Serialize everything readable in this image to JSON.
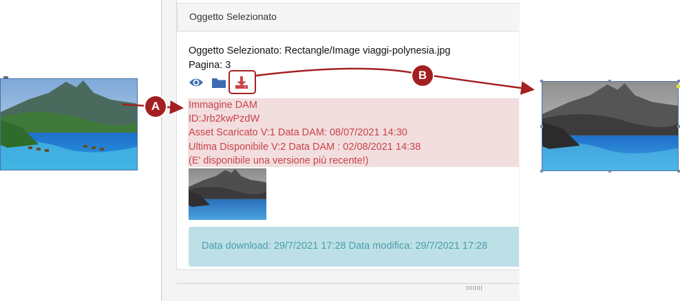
{
  "panel": {
    "header_title": "Oggetto Selezionato",
    "object_line": "Oggetto Selezionato: Rectangle/Image viaggi-polynesia.jpg",
    "page_line": "Pagina: 3"
  },
  "toolbar": {
    "icons": [
      "eye-icon",
      "folder-icon",
      "download-icon"
    ]
  },
  "alert": {
    "lines": [
      "Immagine DAM",
      "ID:Jrb2kwPzdW",
      "Asset Scaricato V:1 Data DAM: 08/07/2021 14:30",
      "Ultima Disponibile V:2 Data DAM : 02/08/2021 14:38",
      "(E' disponibile una versione più recente!)"
    ]
  },
  "info": {
    "text": "Data download: 29/7/2021 17:28 Data modifica: 29/7/2021 17:28"
  },
  "annotations": {
    "marker_a": "A",
    "marker_b": "B"
  },
  "colors": {
    "annotation": "#a42020",
    "icon_blue": "#3b6cb4",
    "alert_bg": "#f2dede",
    "alert_text": "#c9424a",
    "info_bg": "#bde0e6",
    "info_text": "#4b9ea9"
  }
}
